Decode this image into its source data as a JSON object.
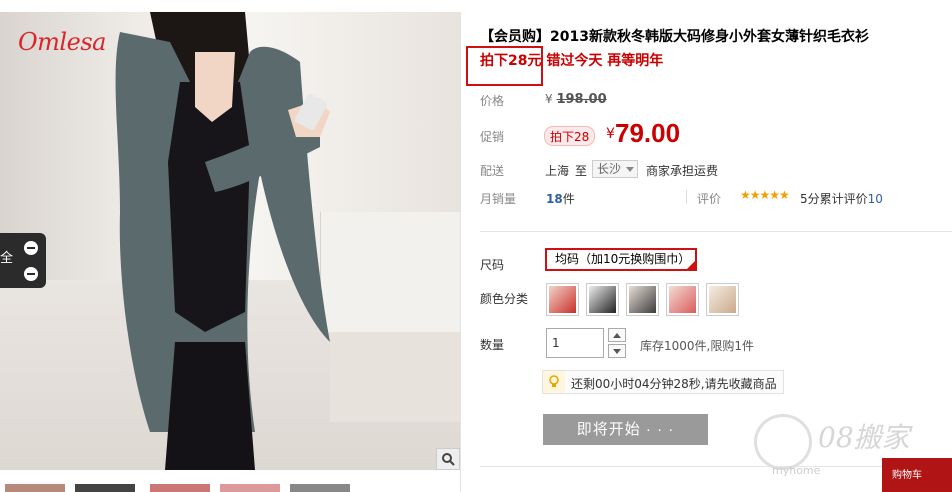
{
  "product": {
    "brand": "Omlesa",
    "title": "【会员购】2013新款秋冬韩版大码修身小外套女薄针织毛衣衫",
    "promo": "拍下28元 错过今天 再等明年"
  },
  "labels": {
    "price": "价格",
    "promo_price": "促销",
    "shipping": "配送",
    "monthly_sales": "月销量",
    "reviews": "评价",
    "size": "尺码",
    "color": "颜色分类",
    "quantity": "数量"
  },
  "price": {
    "original_prefix": "¥",
    "original": "198.00",
    "badge": "拍下28",
    "yen": "¥",
    "current": "79.00"
  },
  "shipping": {
    "from": "上海",
    "to_word": "至",
    "city": "长沙",
    "note": "商家承担运费"
  },
  "sales": {
    "count": "18",
    "unit": "件"
  },
  "reviews": {
    "stars": "★★★★★",
    "text_prefix": "5分累计评价",
    "count": "10"
  },
  "size": {
    "selected": "均码（加10元换购围巾）"
  },
  "colors": {
    "swatch_colors": [
      "#c9302c",
      "#222222",
      "#3d3d3d",
      "#d95c5c",
      "#e8cdb4"
    ]
  },
  "quantity": {
    "value": "1",
    "stock_text": "库存1000件,限购1件"
  },
  "tip": {
    "text": "还剩00小时04分钟28秒,请先收藏商品"
  },
  "buy": {
    "label": "即将开始 · · ·"
  },
  "side_float": {
    "text": "全"
  },
  "watermark": {
    "big": "08搬家",
    "small": "myhome",
    "tab": "购物车"
  }
}
